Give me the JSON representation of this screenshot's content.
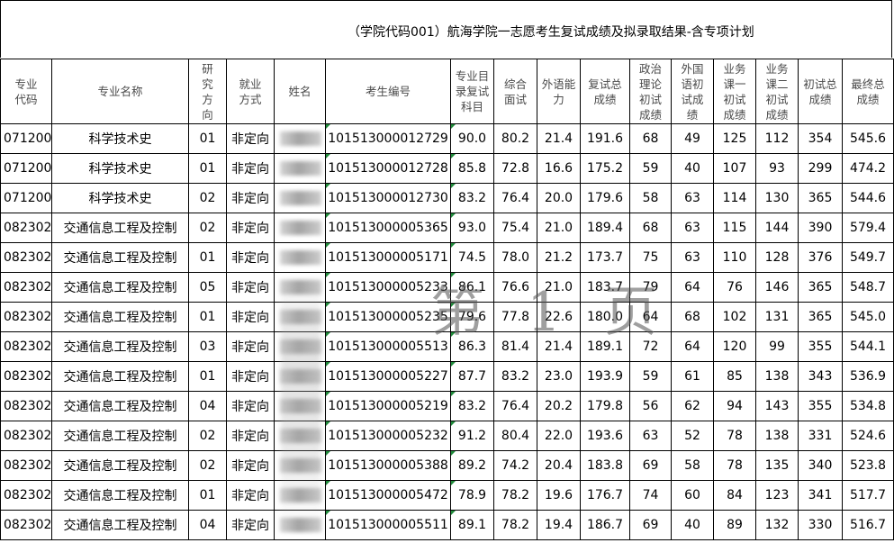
{
  "title": "（学院代码001）航海学院一志愿考生复试成绩及拟录取结果-含专项计划",
  "watermark": "第 1 页",
  "headers": [
    "专业代码",
    "专业名称",
    "研究方向",
    "就业方式",
    "姓名",
    "考生编号",
    "专业目录复试科目",
    "综合面试",
    "外语能力",
    "复试总成绩",
    "政治理论初试成绩",
    "外国语初试成绩",
    "业务课一初试成绩",
    "业务课二初试成绩",
    "初试总成绩",
    "最终总成绩"
  ],
  "rows": [
    {
      "code": "071200",
      "major": "科学技术史",
      "dir": "01",
      "emp": "非定向",
      "id": "101513000012729",
      "s1": "90.0",
      "s2": "80.2",
      "s3": "21.4",
      "fs": "191.6",
      "p": "68",
      "f": "49",
      "b1": "125",
      "b2": "112",
      "it": "354",
      "tot": "545.6"
    },
    {
      "code": "071200",
      "major": "科学技术史",
      "dir": "01",
      "emp": "非定向",
      "id": "101513000012728",
      "s1": "85.8",
      "s2": "72.8",
      "s3": "16.6",
      "fs": "175.2",
      "p": "59",
      "f": "40",
      "b1": "107",
      "b2": "93",
      "it": "299",
      "tot": "474.2"
    },
    {
      "code": "071200",
      "major": "科学技术史",
      "dir": "02",
      "emp": "非定向",
      "id": "101513000012730",
      "s1": "83.2",
      "s2": "76.4",
      "s3": "20.0",
      "fs": "179.6",
      "p": "58",
      "f": "63",
      "b1": "114",
      "b2": "130",
      "it": "365",
      "tot": "544.6"
    },
    {
      "code": "082302",
      "major": "交通信息工程及控制",
      "dir": "02",
      "emp": "非定向",
      "id": "101513000005365",
      "s1": "93.0",
      "s2": "75.4",
      "s3": "21.0",
      "fs": "189.4",
      "p": "68",
      "f": "63",
      "b1": "115",
      "b2": "144",
      "it": "390",
      "tot": "579.4"
    },
    {
      "code": "082302",
      "major": "交通信息工程及控制",
      "dir": "01",
      "emp": "非定向",
      "id": "101513000005171",
      "s1": "74.5",
      "s2": "78.0",
      "s3": "21.2",
      "fs": "173.7",
      "p": "75",
      "f": "63",
      "b1": "110",
      "b2": "128",
      "it": "376",
      "tot": "549.7"
    },
    {
      "code": "082302",
      "major": "交通信息工程及控制",
      "dir": "05",
      "emp": "非定向",
      "id": "101513000005233",
      "s1": "86.1",
      "s2": "76.6",
      "s3": "21.0",
      "fs": "183.7",
      "p": "79",
      "f": "64",
      "b1": "76",
      "b2": "146",
      "it": "365",
      "tot": "548.7"
    },
    {
      "code": "082302",
      "major": "交通信息工程及控制",
      "dir": "01",
      "emp": "非定向",
      "id": "101513000005235",
      "s1": "79.6",
      "s2": "77.8",
      "s3": "22.6",
      "fs": "180.0",
      "p": "64",
      "f": "68",
      "b1": "102",
      "b2": "131",
      "it": "365",
      "tot": "545.0"
    },
    {
      "code": "082302",
      "major": "交通信息工程及控制",
      "dir": "03",
      "emp": "非定向",
      "id": "101513000005513",
      "s1": "86.3",
      "s2": "81.4",
      "s3": "21.4",
      "fs": "189.1",
      "p": "72",
      "f": "64",
      "b1": "120",
      "b2": "99",
      "it": "355",
      "tot": "544.1"
    },
    {
      "code": "082302",
      "major": "交通信息工程及控制",
      "dir": "01",
      "emp": "非定向",
      "id": "101513000005227",
      "s1": "87.7",
      "s2": "83.2",
      "s3": "23.0",
      "fs": "193.9",
      "p": "59",
      "f": "61",
      "b1": "85",
      "b2": "138",
      "it": "343",
      "tot": "536.9"
    },
    {
      "code": "082302",
      "major": "交通信息工程及控制",
      "dir": "04",
      "emp": "非定向",
      "id": "101513000005219",
      "s1": "83.2",
      "s2": "76.4",
      "s3": "20.2",
      "fs": "179.8",
      "p": "56",
      "f": "62",
      "b1": "94",
      "b2": "143",
      "it": "355",
      "tot": "534.8"
    },
    {
      "code": "082302",
      "major": "交通信息工程及控制",
      "dir": "02",
      "emp": "非定向",
      "id": "101513000005232",
      "s1": "91.2",
      "s2": "80.4",
      "s3": "22.0",
      "fs": "193.6",
      "p": "63",
      "f": "52",
      "b1": "78",
      "b2": "138",
      "it": "331",
      "tot": "524.6"
    },
    {
      "code": "082302",
      "major": "交通信息工程及控制",
      "dir": "02",
      "emp": "非定向",
      "id": "101513000005388",
      "s1": "89.2",
      "s2": "74.2",
      "s3": "20.4",
      "fs": "183.8",
      "p": "69",
      "f": "58",
      "b1": "78",
      "b2": "135",
      "it": "340",
      "tot": "523.8"
    },
    {
      "code": "082302",
      "major": "交通信息工程及控制",
      "dir": "01",
      "emp": "非定向",
      "id": "101513000005472",
      "s1": "78.9",
      "s2": "78.2",
      "s3": "19.6",
      "fs": "176.7",
      "p": "74",
      "f": "60",
      "b1": "84",
      "b2": "123",
      "it": "341",
      "tot": "517.7"
    },
    {
      "code": "082302",
      "major": "交通信息工程及控制",
      "dir": "04",
      "emp": "非定向",
      "id": "101513000005511",
      "s1": "89.1",
      "s2": "78.2",
      "s3": "19.4",
      "fs": "186.7",
      "p": "69",
      "f": "40",
      "b1": "89",
      "b2": "132",
      "it": "330",
      "tot": "516.7"
    }
  ]
}
